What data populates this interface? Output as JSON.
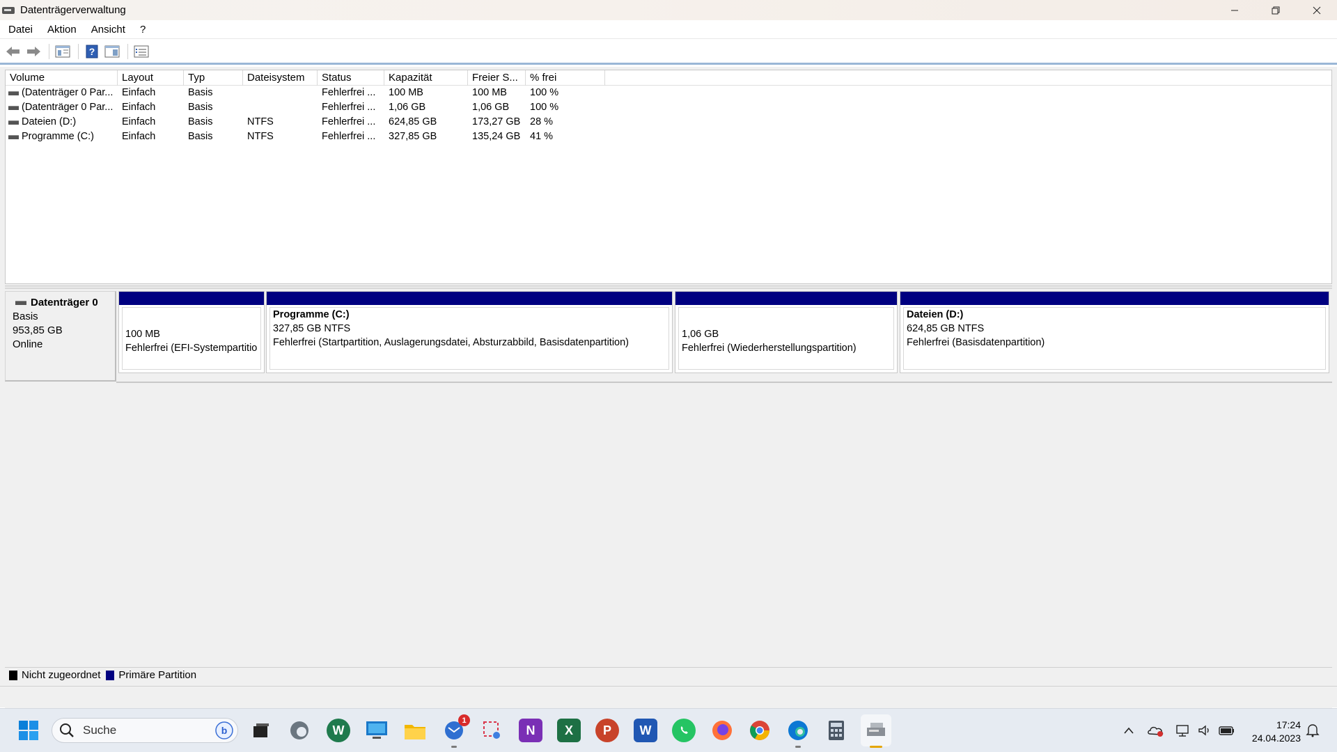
{
  "window": {
    "title": "Datenträgerverwaltung",
    "controls": {
      "minimize": "—",
      "restore": "❐",
      "close": "✕"
    }
  },
  "menu": [
    "Datei",
    "Aktion",
    "Ansicht",
    "?"
  ],
  "toolbar": {
    "icons": [
      "back-icon",
      "forward-icon",
      "console-tree-icon",
      "help-icon",
      "action-pane-icon",
      "properties-icon"
    ]
  },
  "volume_table": {
    "columns": [
      "Volume",
      "Layout",
      "Typ",
      "Dateisystem",
      "Status",
      "Kapazität",
      "Freier S...",
      "% frei"
    ],
    "rows": [
      [
        "(Datenträger 0 Par...",
        "Einfach",
        "Basis",
        "",
        "Fehlerfrei ...",
        "100 MB",
        "100 MB",
        "100 %"
      ],
      [
        "(Datenträger 0 Par...",
        "Einfach",
        "Basis",
        "",
        "Fehlerfrei ...",
        "1,06 GB",
        "1,06 GB",
        "100 %"
      ],
      [
        "Dateien (D:)",
        "Einfach",
        "Basis",
        "NTFS",
        "Fehlerfrei ...",
        "624,85 GB",
        "173,27 GB",
        "28 %"
      ],
      [
        "Programme (C:)",
        "Einfach",
        "Basis",
        "NTFS",
        "Fehlerfrei ...",
        "327,85 GB",
        "135,24 GB",
        "41 %"
      ]
    ]
  },
  "disk": {
    "name": "Datenträger 0",
    "type": "Basis",
    "size": "953,85 GB",
    "status": "Online",
    "partitions": [
      {
        "name": "",
        "size": "100 MB",
        "status": "Fehlerfrei (EFI-Systempartitio"
      },
      {
        "name": "Programme  (C:)",
        "size": "327,85 GB NTFS",
        "status": "Fehlerfrei (Startpartition, Auslagerungsdatei, Absturzabbild, Basisdatenpartition)"
      },
      {
        "name": "",
        "size": "1,06 GB",
        "status": "Fehlerfrei (Wiederherstellungspartition)"
      },
      {
        "name": "Dateien  (D:)",
        "size": "624,85 GB NTFS",
        "status": "Fehlerfrei (Basisdatenpartition)"
      }
    ]
  },
  "legend": [
    {
      "label": "Nicht zugeordnet",
      "color": "#000000"
    },
    {
      "label": "Primäre Partition",
      "color": "#000080"
    }
  ],
  "taskbar": {
    "search_placeholder": "Suche",
    "mail_badge": "1",
    "time": "17:24",
    "date": "24.04.2023",
    "apps": [
      "start-icon",
      "search-icon",
      "bing-icon",
      "task-view-icon",
      "edge-legacy-icon",
      "wordpad-icon",
      "remote-desktop-icon",
      "file-explorer-icon",
      "mail-icon",
      "snipping-tool-icon",
      "onenote-icon",
      "excel-icon",
      "powerpoint-icon",
      "word-icon",
      "whatsapp-icon",
      "firefox-icon",
      "chrome-icon",
      "edge-icon",
      "calculator-icon",
      "disk-management-icon"
    ],
    "tray": [
      "chevron-up-icon",
      "onedrive-icon",
      "network-icon",
      "volume-icon",
      "battery-icon",
      "notification-icon"
    ]
  }
}
